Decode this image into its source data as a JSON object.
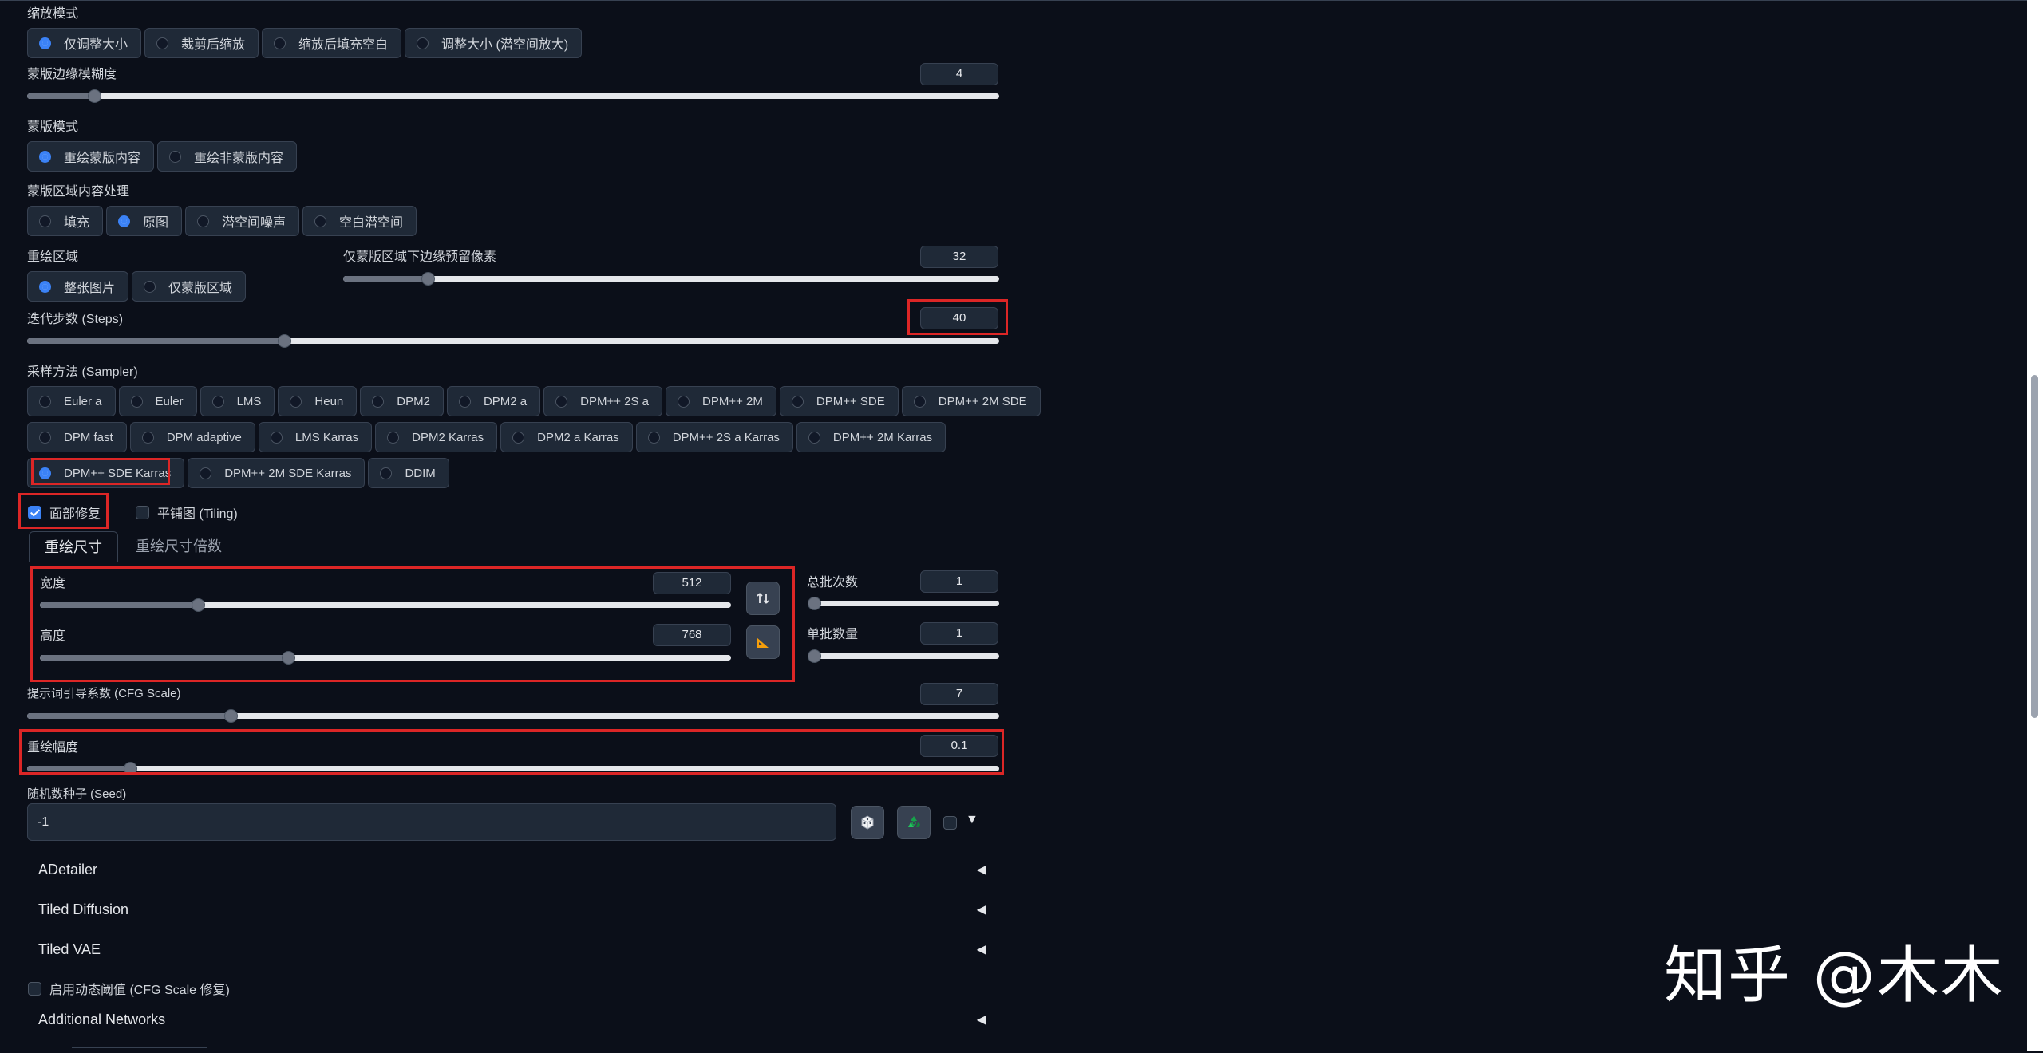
{
  "resize_mode": {
    "label": "缩放模式",
    "options": [
      "仅调整大小",
      "裁剪后缩放",
      "缩放后填充空白",
      "调整大小 (潜空间放大)"
    ],
    "selected": 0
  },
  "mask_blur": {
    "label": "蒙版边缘模糊度",
    "value": "4",
    "fraction": 0.07
  },
  "mask_mode": {
    "label": "蒙版模式",
    "options": [
      "重绘蒙版内容",
      "重绘非蒙版内容"
    ],
    "selected": 0
  },
  "masked_content": {
    "label": "蒙版区域内容处理",
    "options": [
      "填充",
      "原图",
      "潜空间噪声",
      "空白潜空间"
    ],
    "selected": 1
  },
  "inpaint_area": {
    "label": "重绘区域",
    "options": [
      "整张图片",
      "仅蒙版区域"
    ],
    "selected": 0
  },
  "only_masked_padding": {
    "label": "仅蒙版区域下边缘预留像素",
    "value": "32",
    "fraction": 0.13
  },
  "steps": {
    "label": "迭代步数 (Steps)",
    "value": "40",
    "fraction": 0.265
  },
  "sampler": {
    "label": "采样方法 (Sampler)",
    "rows": [
      [
        "Euler a",
        "Euler",
        "LMS",
        "Heun",
        "DPM2",
        "DPM2 a",
        "DPM++ 2S a",
        "DPM++ 2M",
        "DPM++ SDE",
        "DPM++ 2M SDE"
      ],
      [
        "DPM fast",
        "DPM adaptive",
        "LMS Karras",
        "DPM2 Karras",
        "DPM2 a Karras",
        "DPM++ 2S a Karras",
        "DPM++ 2M Karras"
      ],
      [
        "DPM++ SDE Karras",
        "DPM++ 2M SDE Karras",
        "DDIM"
      ]
    ],
    "selected": "DPM++ SDE Karras"
  },
  "restore_faces": {
    "label": "面部修复",
    "checked": true
  },
  "tiling": {
    "label": "平铺图 (Tiling)",
    "checked": false
  },
  "size_tabs": {
    "tabs": [
      "重绘尺寸",
      "重绘尺寸倍数"
    ],
    "active": 0
  },
  "width": {
    "label": "宽度",
    "value": "512",
    "fraction": 0.23
  },
  "height": {
    "label": "高度",
    "value": "768",
    "fraction": 0.36
  },
  "batch_count": {
    "label": "总批次数",
    "value": "1",
    "fraction": 0.0
  },
  "batch_size": {
    "label": "单批数量",
    "value": "1",
    "fraction": 0.0
  },
  "cfg_scale": {
    "label": "提示词引导系数 (CFG Scale)",
    "value": "7",
    "fraction": 0.21
  },
  "denoising": {
    "label": "重绘幅度",
    "value": "0.1",
    "fraction": 0.107
  },
  "seed": {
    "label": "随机数种子 (Seed)",
    "value": "-1"
  },
  "accordions": [
    "ADetailer",
    "Tiled Diffusion",
    "Tiled VAE"
  ],
  "dynamic_threshold": {
    "label": "启用动态阈值 (CFG Scale 修复)",
    "checked": false
  },
  "additional_networks": "Additional Networks",
  "watermark": "知乎 @木木",
  "colors": {
    "accent": "#3b82f6",
    "highlight": "#dc2626",
    "background": "#0b0f19"
  }
}
